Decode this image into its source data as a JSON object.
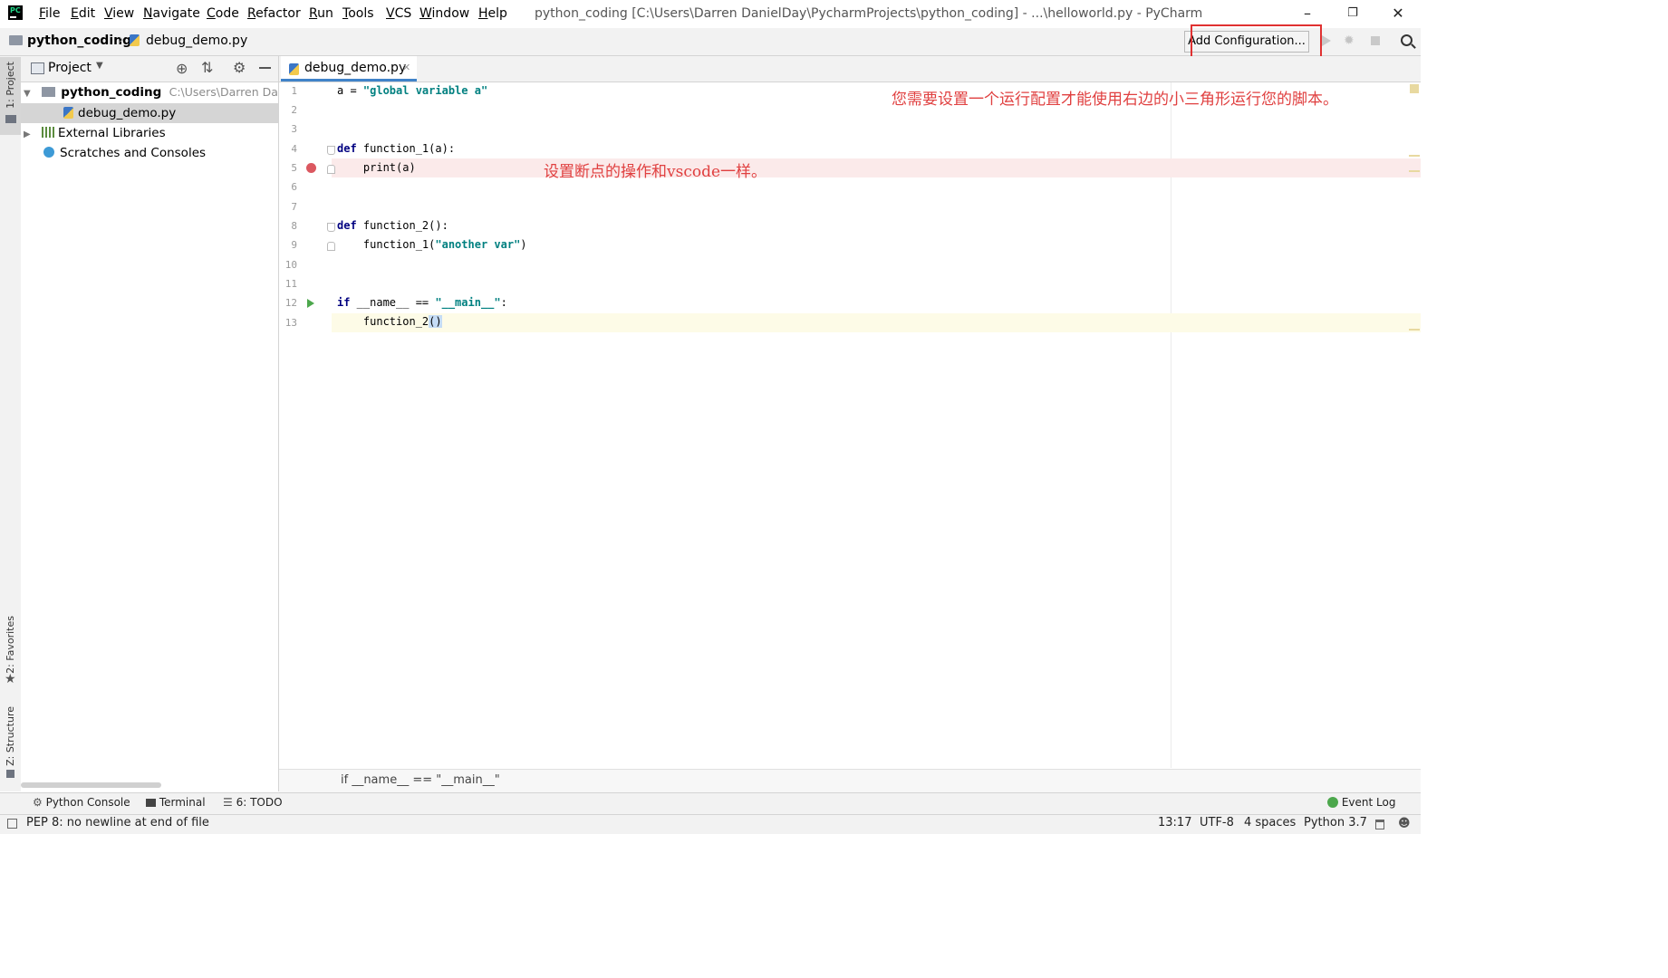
{
  "menu": [
    "File",
    "Edit",
    "View",
    "Navigate",
    "Code",
    "Refactor",
    "Run",
    "Tools",
    "VCS",
    "Window",
    "Help"
  ],
  "window_title": "python_coding [C:\\Users\\Darren DanielDay\\PycharmProjects\\python_coding] - ...\\helloworld.py - PyCharm",
  "nav": {
    "project": "python_coding",
    "file": "debug_demo.py",
    "add_config": "Add Configuration..."
  },
  "side_tabs": {
    "project": "1: Project",
    "favorites": "2: Favorites",
    "structure": "Z: Structure"
  },
  "project_panel": {
    "title": "Project",
    "root": "python_coding",
    "root_path": "C:\\Users\\Darren Danie",
    "file": "debug_demo.py",
    "external": "External Libraries",
    "scratches": "Scratches and Consoles"
  },
  "editor": {
    "tab": "debug_demo.py",
    "line_numbers": [
      "1",
      "2",
      "3",
      "4",
      "5",
      "6",
      "7",
      "8",
      "9",
      "10",
      "11",
      "12",
      "13"
    ],
    "code": {
      "l1_a": "a = ",
      "l1_str": "\"global variable a\"",
      "l4_kw": "def",
      "l4_rest": " function_1(a):",
      "l5": "    print(a)",
      "l8_kw": "def",
      "l8_rest": " function_2():",
      "l9_a": "    function_1(",
      "l9_str": "\"another var\"",
      "l9_b": ")",
      "l12_kw": "if",
      "l12_a": " __name__ == ",
      "l12_str": "\"__main__\"",
      "l12_b": ":",
      "l13_a": "    function_2",
      "l13_b": "()"
    },
    "annotation_top": "您需要设置一个运行配置才能使用右边的小三角形运行您的脚本。",
    "annotation_bp": "设置断点的操作和vscode一样。",
    "breadcrumb": "if __name__ == \"__main__\""
  },
  "bottom_tools": {
    "console": "Python Console",
    "terminal": "Terminal",
    "todo": "6: TODO",
    "event_log": "Event Log"
  },
  "status": {
    "message": "PEP 8: no newline at end of file",
    "position": "13:17",
    "encoding": "UTF-8",
    "indent": "4 spaces",
    "interpreter": "Python 3.7"
  },
  "colors": {
    "accent": "#4083c9",
    "breakpoint": "#db5860",
    "annotation": "#e04040",
    "highlight_box": "#e03131"
  }
}
